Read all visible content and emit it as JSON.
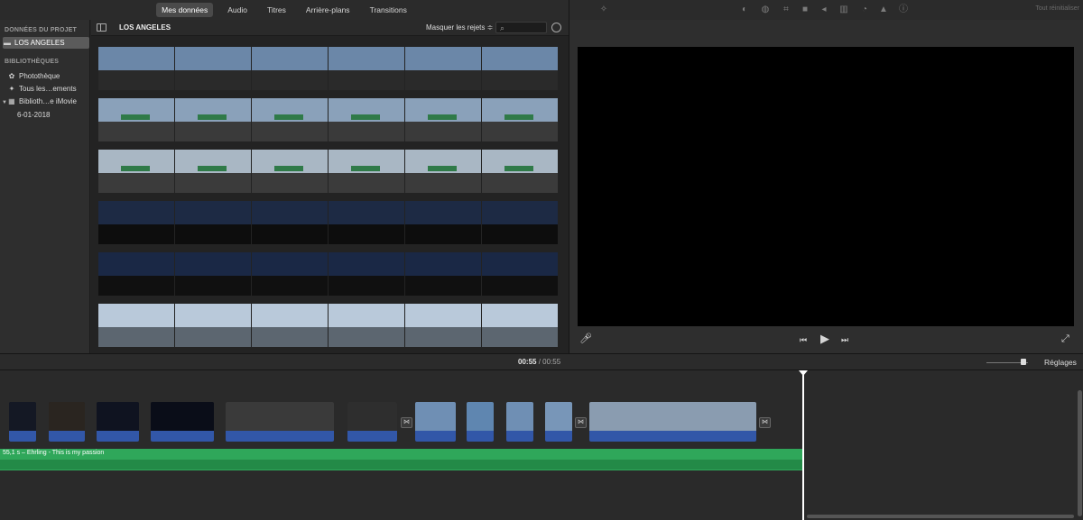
{
  "nav": {
    "tabs": [
      "Mes données",
      "Audio",
      "Titres",
      "Arrière-plans",
      "Transitions"
    ],
    "active_index": 0
  },
  "viewer_toolbar": {
    "icons": [
      "magic-wand-icon",
      "color-balance-icon",
      "color-correction-icon",
      "crop-icon",
      "stabilization-icon",
      "volume-icon",
      "equalizer-icon",
      "speed-icon",
      "noise-reduction-icon",
      "clip-filter-icon",
      "info-icon"
    ],
    "reset_label": "Tout réinitialiser"
  },
  "sidebar": {
    "project_header": "DONNÉES DU PROJET",
    "project_item": "LOS ANGELES",
    "libraries_header": "BIBLIOTHÈQUES",
    "library_items": [
      {
        "label": "Photothèque",
        "icon": "photos-icon"
      },
      {
        "label": "Tous les…ements",
        "icon": "star-icon"
      },
      {
        "label": "Biblioth…e iMovie",
        "icon": "library-icon"
      }
    ],
    "event": "6-01-2018"
  },
  "browser": {
    "title": "LOS ANGELES",
    "filter": "Masquer les rejets ≑",
    "search_placeholder": ""
  },
  "timeline": {
    "current_time": "00:55",
    "separator": "/",
    "total_time": "00:55",
    "settings_label": "Réglages",
    "audio_label": "55,1 s – Ehrling - This is my passion"
  },
  "colors": {
    "accent": "#3257a8",
    "audio": "#2fa75a",
    "selection": "#5b5b5b"
  }
}
